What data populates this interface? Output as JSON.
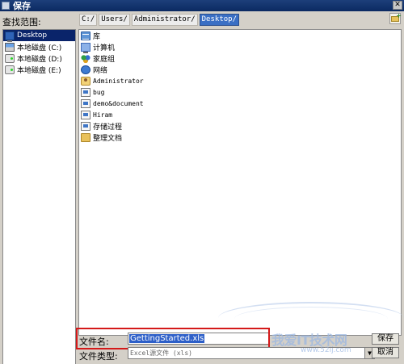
{
  "window": {
    "title": "保存"
  },
  "lookin": {
    "label": "查找范围:",
    "path": [
      "C:/",
      "Users/",
      "Administrator/",
      "Desktop/"
    ]
  },
  "sidebar": {
    "items": [
      {
        "label": "Desktop",
        "icon": "desktop-icon",
        "selected": true
      },
      {
        "label": "本地磁盘 (C:)",
        "icon": "drive-c-icon"
      },
      {
        "label": "本地磁盘 (D:)",
        "icon": "drive-icon"
      },
      {
        "label": "本地磁盘 (E:)",
        "icon": "drive-icon"
      }
    ]
  },
  "files": [
    {
      "label": "库",
      "icon": "library-icon"
    },
    {
      "label": "计算机",
      "icon": "computer-icon"
    },
    {
      "label": "家庭组",
      "icon": "homegroup-icon"
    },
    {
      "label": "网络",
      "icon": "network-icon"
    },
    {
      "label": "Administrator",
      "icon": "user-folder-icon"
    },
    {
      "label": "bug",
      "icon": "document-icon"
    },
    {
      "label": "demo&document",
      "icon": "document-icon"
    },
    {
      "label": "Hiram",
      "icon": "document-icon"
    },
    {
      "label": "存储过程",
      "icon": "document-icon"
    },
    {
      "label": "整理文档",
      "icon": "folder-icon"
    }
  ],
  "bottom": {
    "filename_label": "文件名:",
    "filename_value": "GettingStarted.xls",
    "filetype_label": "文件类型:",
    "filetype_value": "Excel源文件 (xls)",
    "save_label": "保存",
    "cancel_label": "取消"
  },
  "watermark": {
    "text": "我爱IT技术网",
    "url": "www.52ij.com"
  }
}
